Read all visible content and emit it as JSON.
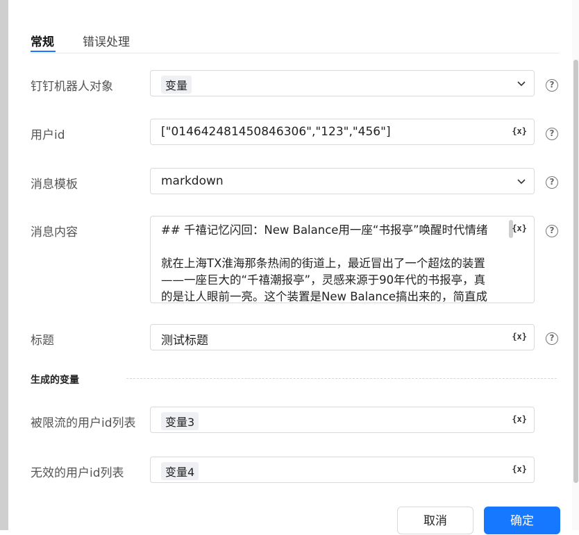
{
  "tabs": [
    {
      "label": "常规",
      "active": true
    },
    {
      "label": "错误处理",
      "active": false
    }
  ],
  "fields": {
    "robot": {
      "label": "钉钉机器人对象",
      "value_tag": "变量"
    },
    "user_id": {
      "label": "用户id",
      "value": "[\"014642481450846306\",\"123\",\"456\"]"
    },
    "template": {
      "label": "消息模板",
      "value": "markdown"
    },
    "content": {
      "label": "消息内容",
      "lines": [
        "## 千禧记忆闪回：New Balance用一座“书报亭”唤醒时代情绪",
        "",
        "就在上海TX淮海那条热闹的街道上，最近冒出了一个超炫的装置",
        "——一座巨大的“千禧潮报亭”，灵感来源于90年代的书报亭，真",
        "的是让人眼前一亮。这个装置是New Balance搞出来的，简直成"
      ]
    },
    "title": {
      "label": "标题",
      "value": "测试标题"
    }
  },
  "generated": {
    "section_title": "生成的变量",
    "limited": {
      "label": "被限流的用户id列表",
      "value_tag": "变量3"
    },
    "invalid": {
      "label": "无效的用户id列表",
      "value_tag": "变量4"
    }
  },
  "icons": {
    "variable": "{x}",
    "help": "?"
  },
  "buttons": {
    "cancel": "取消",
    "ok": "确定"
  },
  "colors": {
    "primary": "#1677ff"
  }
}
